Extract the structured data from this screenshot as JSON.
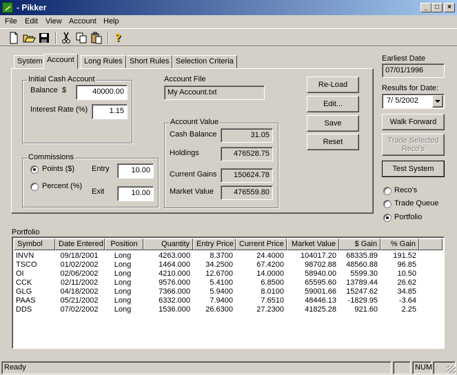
{
  "window": {
    "title": "- Pikker"
  },
  "menu": [
    "File",
    "Edit",
    "View",
    "Account",
    "Help"
  ],
  "tabs": [
    "System",
    "Account",
    "Long Rules",
    "Short Rules",
    "Selection Criteria"
  ],
  "initial_cash": {
    "legend": "Initial Cash Account",
    "balance_label": "Balance",
    "balance_currency": "$",
    "balance_value": "40000.00",
    "interest_label": "Interest Rate (%)",
    "interest_value": "1.15"
  },
  "commissions": {
    "legend": "Commissions",
    "points_label": "Points ($)",
    "percent_label": "Percent (%)",
    "entry_label": "Entry",
    "entry_value": "10.00",
    "exit_label": "Exit",
    "exit_value": "10.00"
  },
  "account_file": {
    "label": "Account File",
    "value": "My Account.txt"
  },
  "account_value": {
    "legend": "Account Value",
    "cash_label": "Cash Balance",
    "cash_value": "31.05",
    "holdings_label": "Holdings",
    "holdings_value": "476528.75",
    "gains_label": "Current Gains",
    "gains_value": "150624.78",
    "market_label": "Market Value",
    "market_value": "476559.80"
  },
  "buttons": {
    "reload": "Re-Load",
    "edit": "Edit...",
    "save": "Save",
    "reset": "Reset"
  },
  "right": {
    "earliest_label": "Earliest Date",
    "earliest_value": "07/01/1996",
    "results_label": "Results for Date:",
    "results_value": "7/ 5/2002",
    "walk_forward": "Walk Forward",
    "trade_selected_1": "Trade Selected",
    "trade_selected_2": "Reco's",
    "test_system": "Test System",
    "views": [
      "Reco's",
      "Trade Queue",
      "Portfolio"
    ]
  },
  "portfolio": {
    "label": "Portfolio",
    "columns": [
      "Symbol",
      "Date Entered",
      "Position",
      "Quantity",
      "Entry Price",
      "Current Price",
      "Market Value",
      "$ Gain",
      "% Gain"
    ],
    "rows": [
      [
        "INVN",
        "09/18/2001",
        "Long",
        "4263.000",
        "8.3700",
        "24.4000",
        "104017.20",
        "68335.89",
        "191.52"
      ],
      [
        "TSCO",
        "01/02/2002",
        "Long",
        "1464.000",
        "34.2500",
        "67.4200",
        "98702.88",
        "48560.88",
        "96.85"
      ],
      [
        "OI",
        "02/06/2002",
        "Long",
        "4210.000",
        "12.6700",
        "14.0000",
        "58940.00",
        "5599.30",
        "10.50"
      ],
      [
        "CCK",
        "02/11/2002",
        "Long",
        "9576.000",
        "5.4100",
        "6.8500",
        "65595.60",
        "13789.44",
        "26.62"
      ],
      [
        "GLG",
        "04/18/2002",
        "Long",
        "7366.000",
        "5.9400",
        "8.0100",
        "59001.66",
        "15247.62",
        "34.85"
      ],
      [
        "PAAS",
        "05/21/2002",
        "Long",
        "6332.000",
        "7.9400",
        "7.6510",
        "48446.13",
        "-1829.95",
        "-3.64"
      ],
      [
        "DDS",
        "07/02/2002",
        "Long",
        "1536.000",
        "26.6300",
        "27.2300",
        "41825.28",
        "921.60",
        "2.25"
      ]
    ]
  },
  "status": {
    "text": "Ready",
    "num": "NUM"
  }
}
